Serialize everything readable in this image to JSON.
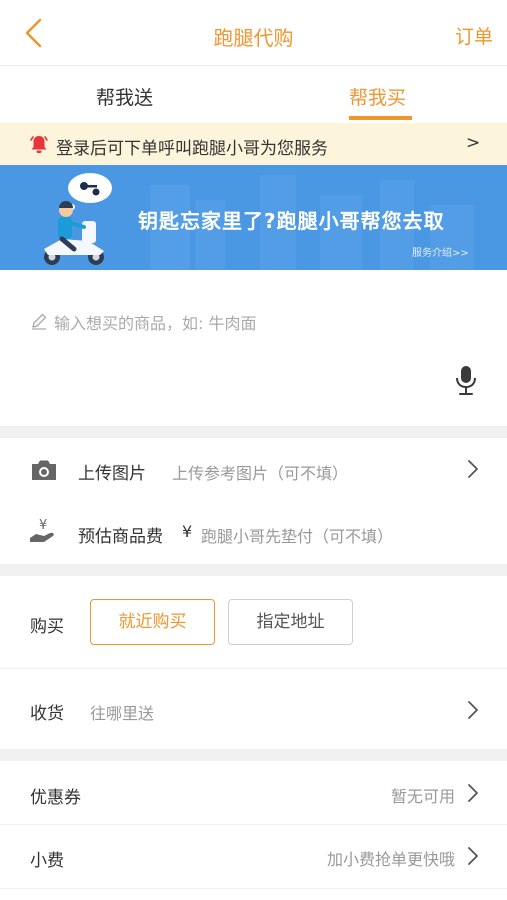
{
  "header": {
    "title": "跑腿代购",
    "orders_label": "订单"
  },
  "tabs": [
    {
      "label": "帮我送"
    },
    {
      "label": "帮我买"
    }
  ],
  "notice": {
    "text": "登录后可下单呼叫跑腿小哥为您服务",
    "arrow": ">"
  },
  "banner": {
    "headline": "钥匙忘家里了?跑腿小哥帮您去取",
    "link": "服务介绍>>"
  },
  "item_input": {
    "placeholder": "输入想买的商品，如: 牛肉面"
  },
  "upload": {
    "label": "上传图片",
    "hint": "上传参考图片（可不填）"
  },
  "estimate": {
    "label": "预估商品费",
    "currency": "¥",
    "hint": "跑腿小哥先垫付（可不填）"
  },
  "purchase": {
    "label": "购买",
    "option_nearby": "就近购买",
    "option_address": "指定地址"
  },
  "delivery": {
    "label": "收货",
    "placeholder": "往哪里送"
  },
  "coupon": {
    "label": "优惠券",
    "value": "暂无可用"
  },
  "tip": {
    "label": "小费",
    "value": "加小费抢单更快哦"
  },
  "colors": {
    "accent": "#f0962f",
    "banner": "#4a97e4",
    "notice_bg": "#fdf4dc",
    "alert_red": "#e8353a"
  }
}
